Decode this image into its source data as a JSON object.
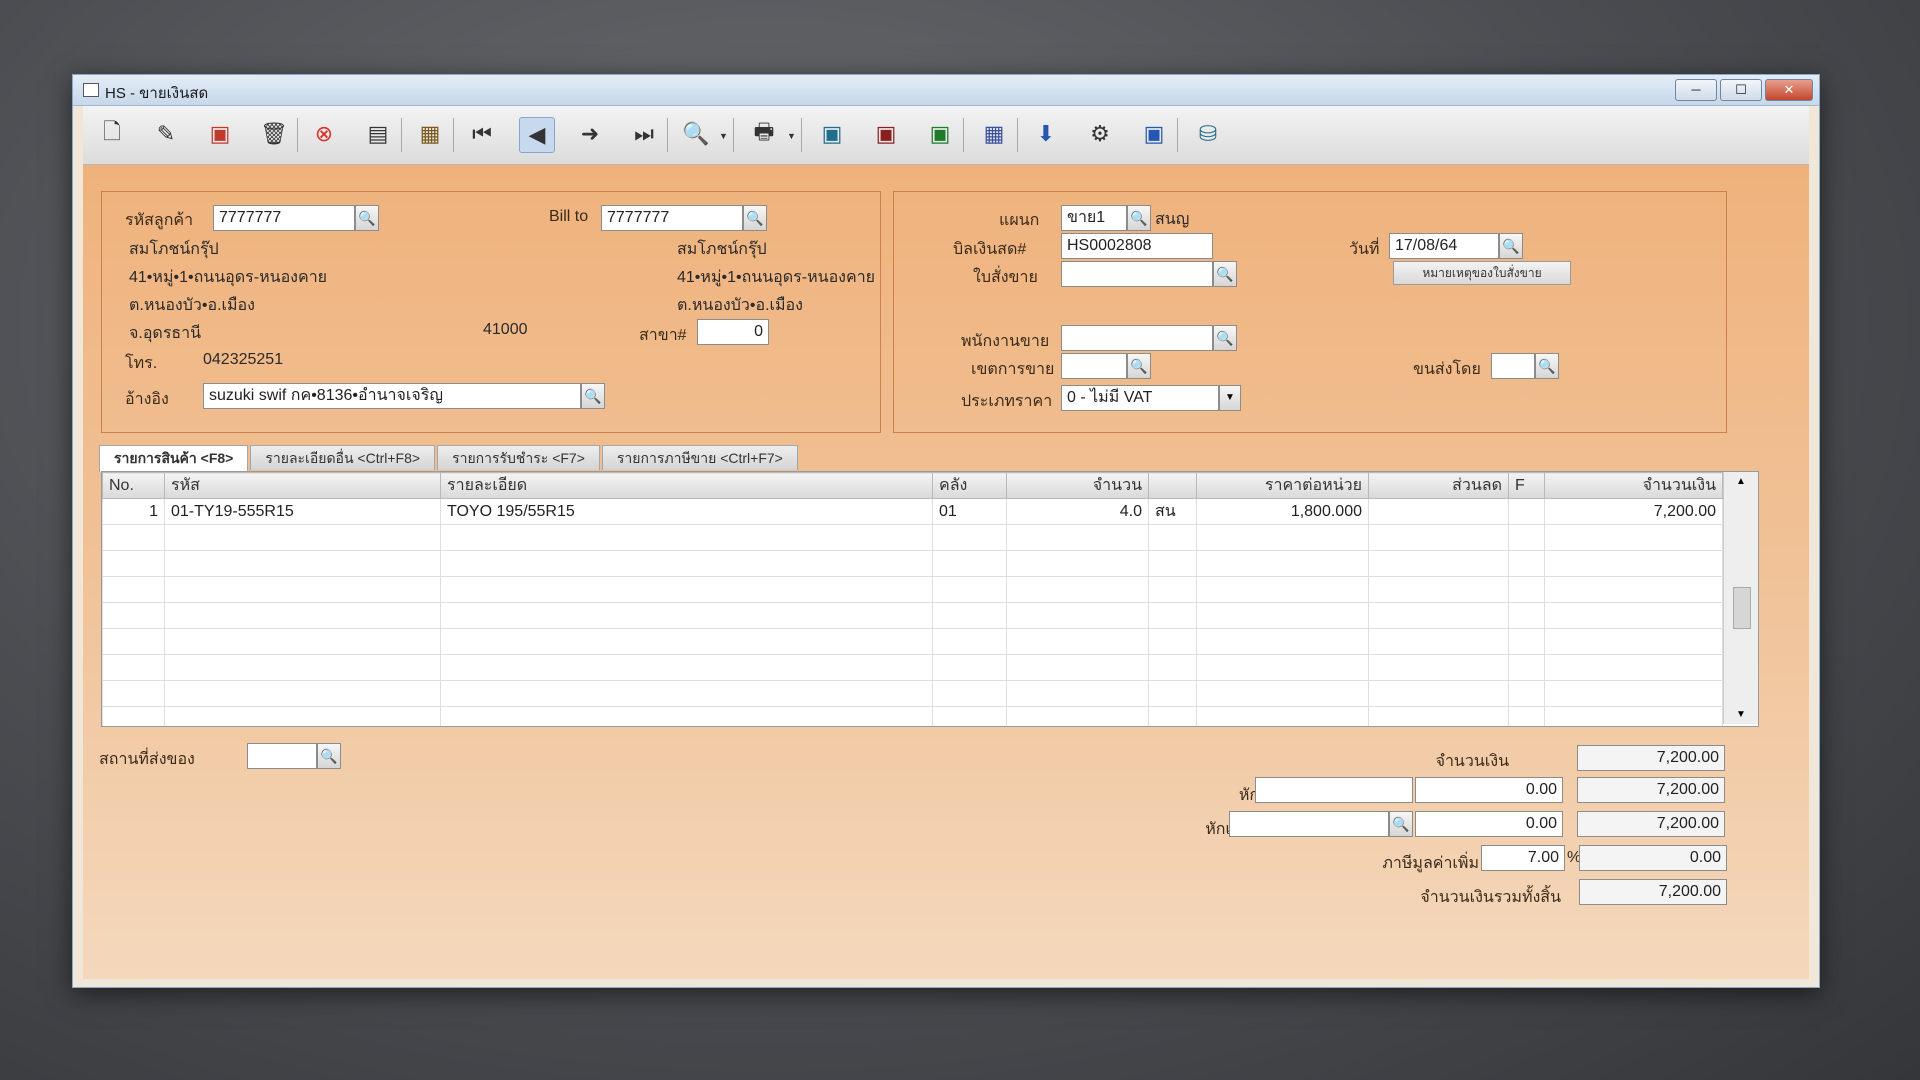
{
  "window": {
    "title": "HS - ขายเงินสด",
    "min": "─",
    "max": "☐",
    "close": "✕"
  },
  "customer": {
    "code_label": "รหัสลูกค้า",
    "code": "7777777",
    "name": "สมโภชน์กรุ๊ป",
    "addr1": "41•หมู่•1•ถนนอุดร-หนองคาย",
    "addr2": "ต.หนองบัว•อ.เมือง",
    "province": "จ.อุดรธานี",
    "zip": "41000",
    "phone_label": "โทร.",
    "phone": "042325251",
    "ref_label": "อ้างอิง",
    "ref": "suzuki swif กค•8136•อำนาจเจริญ"
  },
  "billto": {
    "label": "Bill to",
    "code": "7777777",
    "name": "สมโภชน์กรุ๊ป",
    "addr1": "41•หมู่•1•ถนนอุดร-หนองคาย",
    "addr2": "ต.หนองบัว•อ.เมือง",
    "branch_label": "สาขา#",
    "branch": "0"
  },
  "doc": {
    "dept_label": "แผนก",
    "dept": "ขาย1",
    "dept_name": "สนญ",
    "bill_label": "บิลเงินสด#",
    "bill": "HS0002808",
    "date_label": "วันที่",
    "date": "17/08/64",
    "order_label": "ใบสั่งขาย",
    "order": "",
    "note_button": "หมายเหตุของใบสั่งขาย",
    "salesman_label": "พนักงานขาย",
    "salesman": "",
    "area_label": "เขตการขาย",
    "area": "",
    "ship_label": "ขนส่งโดย",
    "ship": "",
    "price_type_label": "ประเภทราคา",
    "price_type": "0 - ไม่มี VAT"
  },
  "tabs": [
    "รายการสินค้า <F8>",
    "รายละเอียดอื่น <Ctrl+F8>",
    "รายการรับชำระ <F7>",
    "รายการภาษีขาย <Ctrl+F7>"
  ],
  "grid": {
    "headers": [
      "No.",
      "รหัส",
      "รายละเอียด",
      "คลัง",
      "จำนวน",
      "",
      "ราคาต่อหน่วย",
      "ส่วนลด",
      "F",
      "จำนวนเงิน"
    ],
    "rows": [
      [
        "1",
        "01-TY19-555R15",
        "TOYO 195/55R15",
        "01",
        "4.0",
        "สน",
        "1,800.000",
        "",
        "",
        "7,200.00"
      ]
    ]
  },
  "footer": {
    "place_label": "สถานที่ส่งของ",
    "place": "",
    "amount_label": "จำนวนเงิน",
    "amount": "7,200.00",
    "discount_label": "หักส่วนลด",
    "discount_text": "",
    "discount_value": "0.00",
    "discount_total": "7,200.00",
    "deposit_label": "หักเงินมัดจำ",
    "deposit_text": "",
    "deposit_value": "0.00",
    "deposit_total": "7,200.00",
    "vat_label": "ภาษีมูลค่าเพิ่ม",
    "vat_rate": "7.00",
    "vat_pct": "%",
    "vat_value": "0.00",
    "grand_label": "จำนวนเงินรวมทั้งสิ้น",
    "grand_total": "7,200.00"
  },
  "colors": {
    "panel_orange": "#efb27c",
    "titlebar": "#c7d8ea",
    "close_red": "#c4452e"
  }
}
